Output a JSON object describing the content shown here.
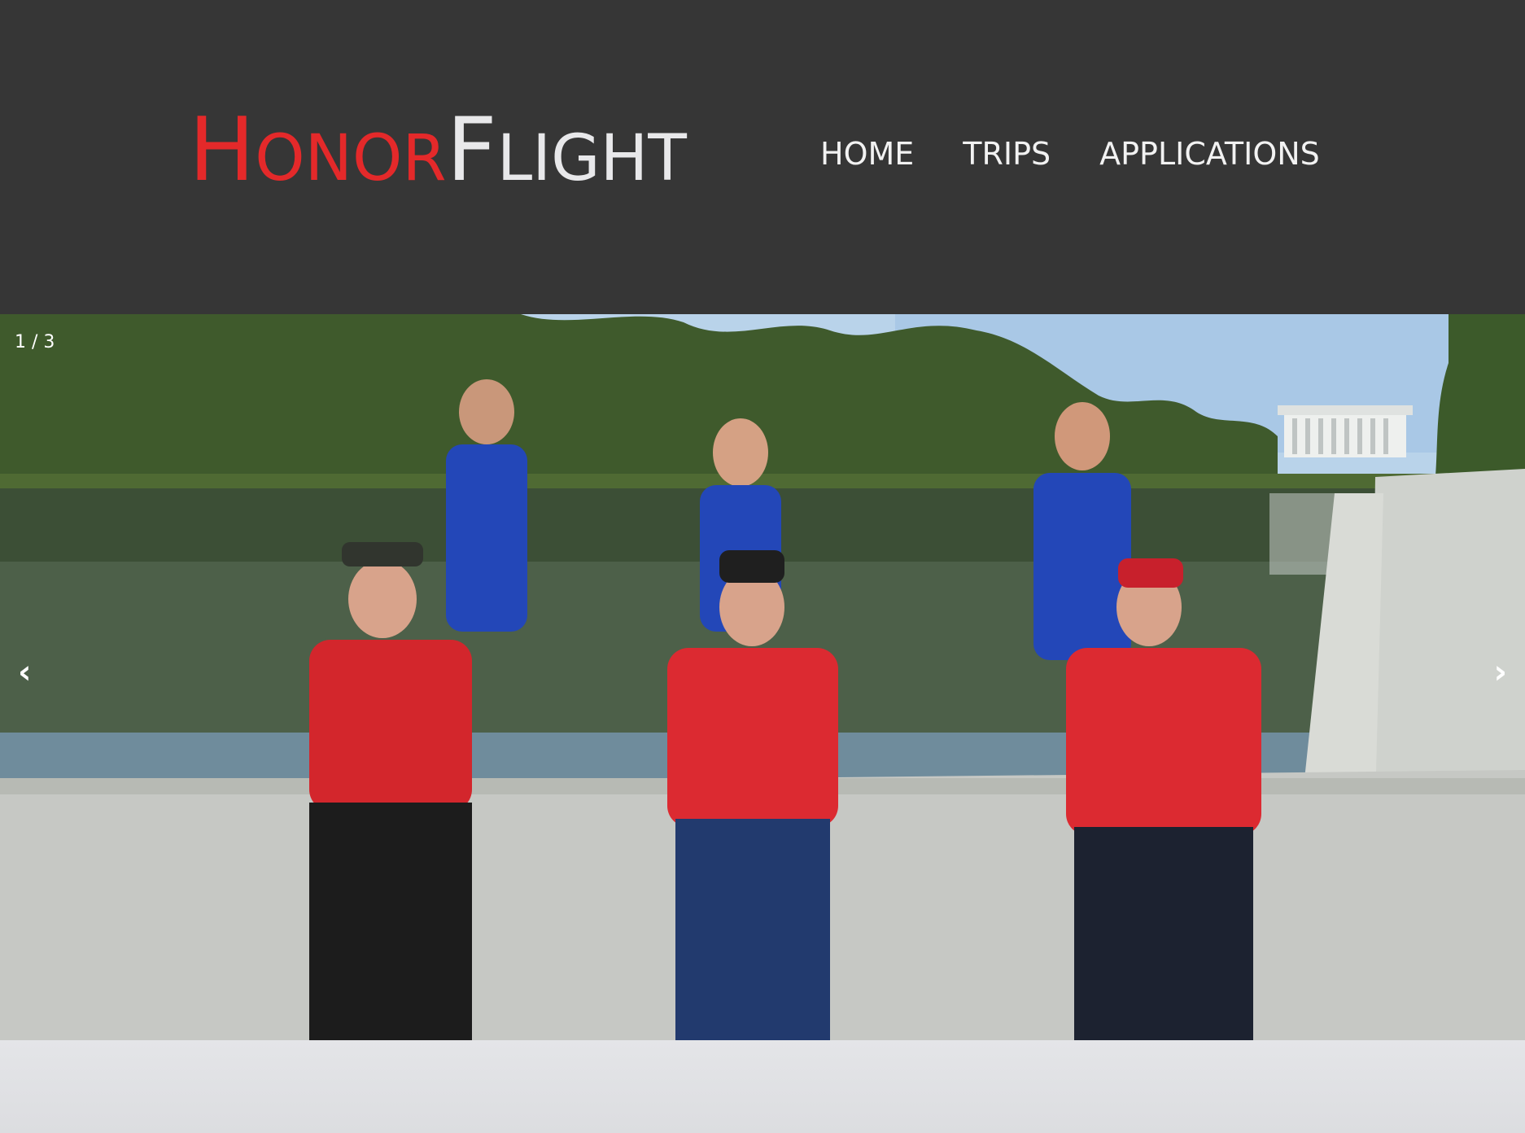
{
  "header": {
    "logo": {
      "word1_cap": "H",
      "word1_rest": "ONOR",
      "word2_cap": "F",
      "word2_rest": "LIGHT",
      "word1_color": "#e4292a",
      "word2_color": "#e8e8ea"
    },
    "nav": [
      {
        "label": "HOME"
      },
      {
        "label": "TRIPS"
      },
      {
        "label": "APPLICATIONS"
      }
    ],
    "background": "#363636"
  },
  "slider": {
    "counter": "1 / 3",
    "prev_icon": "‹",
    "next_icon": "›",
    "current": 1,
    "total": 3
  }
}
